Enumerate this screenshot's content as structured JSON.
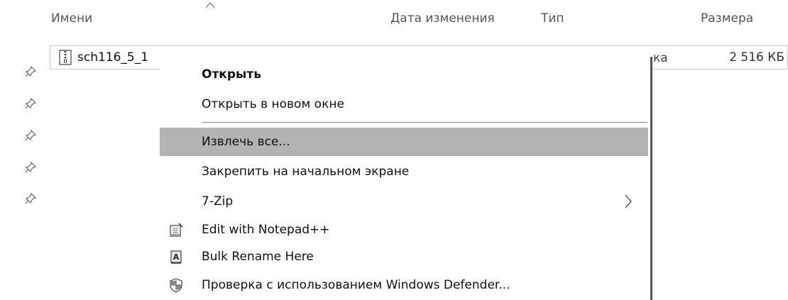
{
  "columns": {
    "name": "Имени",
    "date": "Дата изменения",
    "type": "Тип",
    "size": "Размера"
  },
  "file": {
    "name": "sch116_5_1",
    "type_tail": "ка",
    "size": "2 516 КБ"
  },
  "context_menu": {
    "items": [
      {
        "label": "Открыть"
      },
      {
        "label": "Открыть в новом окне"
      },
      {
        "label": "Извлечь все..."
      },
      {
        "label": "Закрепить на начальном экране"
      },
      {
        "label": "7-Zip"
      },
      {
        "label": "Edit with Notepad++",
        "icon": "notepad-icon"
      },
      {
        "label": "Bulk Rename Here",
        "icon": "bulk-rename-icon"
      },
      {
        "label": "Проверка с использованием Windows Defender...",
        "icon": "defender-icon"
      }
    ]
  },
  "icons": {
    "pins": [
      "pin-icon",
      "pin-icon",
      "pin-icon",
      "pin-icon",
      "pin-icon"
    ],
    "file": "zip-file-icon",
    "sort": "sort-up-icon"
  },
  "colors": {
    "highlight": "#b3b3b3",
    "menu_border": "#555555"
  }
}
